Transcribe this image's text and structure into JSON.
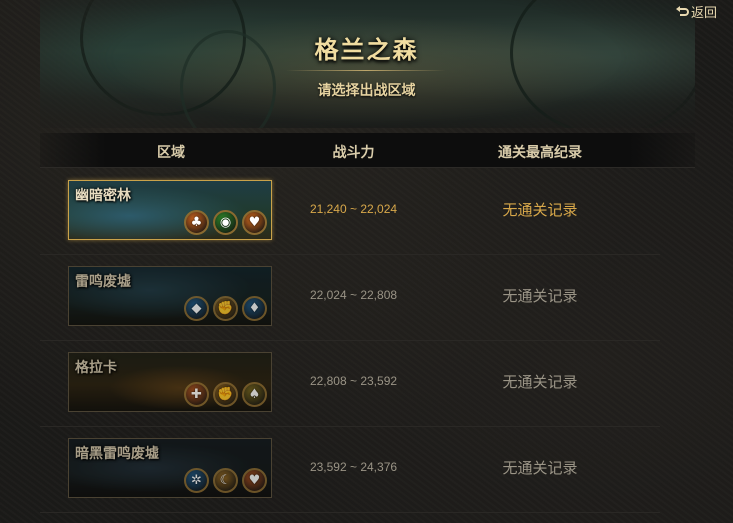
{
  "header": {
    "title": "格兰之森",
    "subtitle": "请选择出战区域",
    "back_label": "返回"
  },
  "columns": [
    "区域",
    "战斗力",
    "通关最高纪录"
  ],
  "zones": [
    {
      "name": "幽暗密林",
      "power": "21,240 ~ 22,024",
      "record": "无通关记录",
      "active": true,
      "icons": [
        "tree-icon",
        "eye-icon",
        "heart-icon"
      ],
      "icon_glyphs": [
        "♣",
        "◉",
        "♥"
      ],
      "icon_colors": [
        "#d0661e",
        "#2f8a2a",
        "#d06a1e"
      ]
    },
    {
      "name": "雷鸣废墟",
      "power": "22,024 ~ 22,808",
      "record": "无通关记录",
      "active": false,
      "icons": [
        "fish-icon",
        "fist-icon",
        "diamond-icon"
      ],
      "icon_glyphs": [
        "◆",
        "✊",
        "♦"
      ],
      "icon_colors": [
        "#1e5a8a",
        "#9a6a1e",
        "#1e5a8a"
      ]
    },
    {
      "name": "格拉卡",
      "power": "22,808 ~ 23,592",
      "record": "无通关记录",
      "active": false,
      "icons": [
        "cross-icon",
        "fist-icon",
        "spade-icon"
      ],
      "icon_glyphs": [
        "✚",
        "✊",
        "♠"
      ],
      "icon_colors": [
        "#b0501e",
        "#9a6a1e",
        "#7a6a1e"
      ]
    },
    {
      "name": "暗黑雷鸣废墟",
      "power": "23,592 ~ 24,376",
      "record": "无通关记录",
      "active": false,
      "icons": [
        "gear-icon",
        "crescent-icon",
        "heart-icon"
      ],
      "icon_glyphs": [
        "✲",
        "☾",
        "♥"
      ],
      "icon_colors": [
        "#1e5a8a",
        "#9a6a1e",
        "#b0501e"
      ]
    }
  ],
  "colors": {
    "accent": "#d8a84a",
    "muted": "#9a9486",
    "title": "#f0dca0"
  }
}
